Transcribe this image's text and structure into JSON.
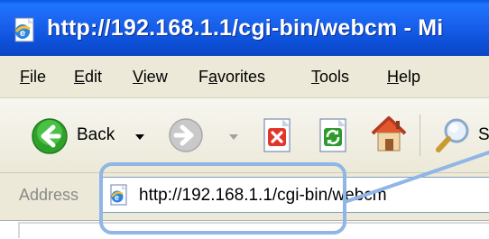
{
  "window": {
    "title": "http://192.168.1.1/cgi-bin/webcm - Mi",
    "title_icon": "ie-page-icon"
  },
  "menu": {
    "items": [
      {
        "label": "File",
        "accel": "F",
        "rest": "ile"
      },
      {
        "label": "Edit",
        "accel": "E",
        "rest": "dit"
      },
      {
        "label": "View",
        "accel": "V",
        "rest": "iew"
      },
      {
        "label": "Favorites",
        "pre": "F",
        "accel": "a",
        "rest": "vorites"
      },
      {
        "label": "Tools",
        "accel": "T",
        "rest": "ools"
      },
      {
        "label": "Help",
        "accel": "H",
        "rest": "elp"
      }
    ]
  },
  "toolbar": {
    "back_label": "Back",
    "icons": [
      "back-arrow-icon",
      "forward-arrow-icon",
      "stop-icon",
      "refresh-icon",
      "home-icon",
      "search-icon"
    ],
    "search_partial": "S"
  },
  "address": {
    "label": "Address",
    "value": "http://192.168.1.1/cgi-bin/webcm"
  },
  "colors": {
    "title_bar": "#1a63ee",
    "chrome": "#ece9d8",
    "callout": "#8fb6e6"
  }
}
